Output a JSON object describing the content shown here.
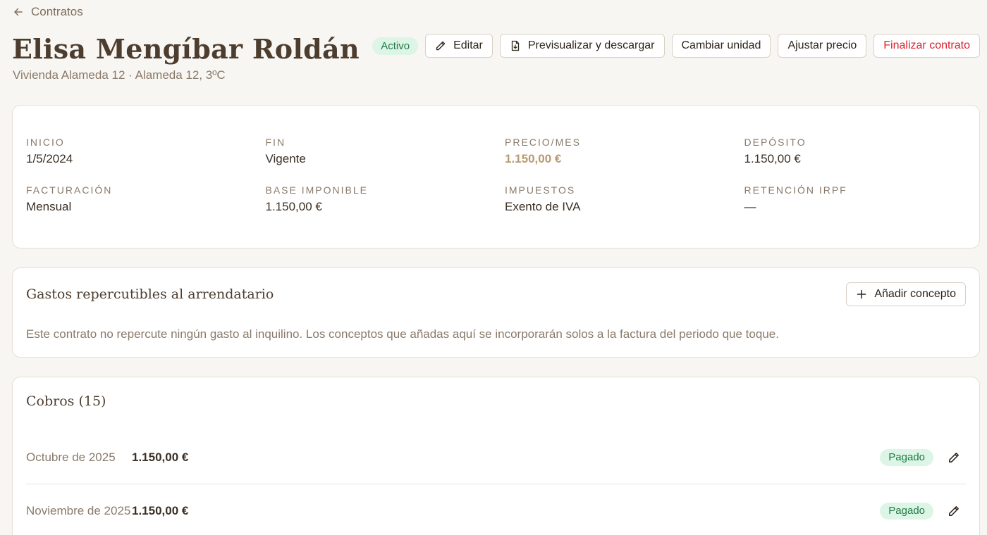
{
  "nav": {
    "back_label": "Contratos"
  },
  "header": {
    "title": "Elisa Mengíbar Roldán",
    "subtitle": "Vivienda Alameda 12 · Alameda 12, 3ºC",
    "status": "Activo"
  },
  "actions": {
    "edit": "Editar",
    "preview": "Previsualizar y descargar",
    "change_unit": "Cambiar unidad",
    "adjust_price": "Ajustar precio",
    "finish": "Finalizar contrato"
  },
  "summary": {
    "items": [
      {
        "label": "Inicio",
        "value": "1/5/2024"
      },
      {
        "label": "Fin",
        "value": "Vigente"
      },
      {
        "label": "Precio/mes",
        "value": "1.150,00 €"
      },
      {
        "label": "Depósito",
        "value": "1.150,00 €"
      },
      {
        "label": "Facturación",
        "value": "Mensual"
      },
      {
        "label": "Base imponible",
        "value": "1.150,00 €"
      },
      {
        "label": "Impuestos",
        "value": "Exento de IVA"
      },
      {
        "label": "Retención IRPF",
        "value": "—"
      }
    ]
  },
  "gastos": {
    "title": "Gastos repercutibles al arrendatario",
    "add_label": "Añadir concepto",
    "empty_text": "Este contrato no repercute ningún gasto al inquilino. Los conceptos que añadas aquí se incorporarán solos a la factura del periodo que toque."
  },
  "cobros": {
    "title": "Cobros (15)",
    "rows": [
      {
        "period": "Octubre de 2025",
        "amount": "1.150,00 €",
        "status": "Pagado"
      },
      {
        "period": "Noviembre de 2025",
        "amount": "1.150,00 €",
        "status": "Pagado"
      }
    ]
  },
  "colors": {
    "accent": "#b89a72",
    "danger": "#d8232f",
    "success_bg": "#dcf5e6",
    "success_text": "#1f7a43"
  }
}
